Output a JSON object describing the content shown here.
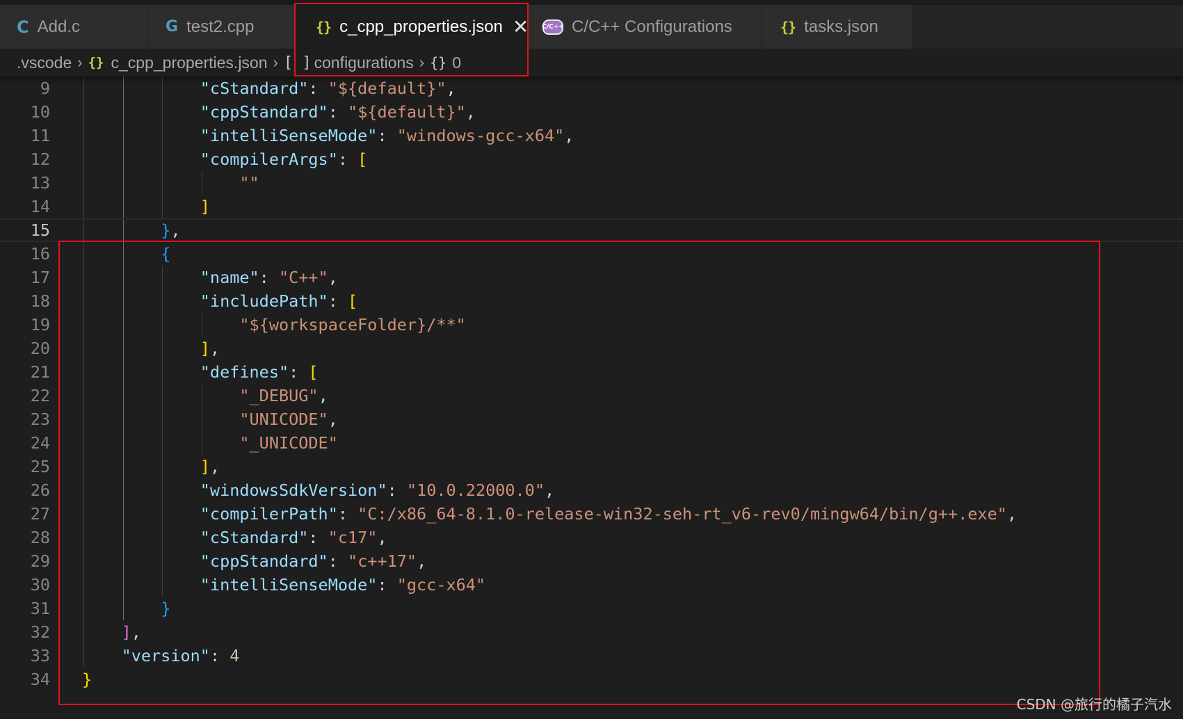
{
  "tabs": [
    {
      "label": "Add.c",
      "icon": "c-file-icon",
      "glyph": "C"
    },
    {
      "label": "test2.cpp",
      "icon": "cpp-file-icon",
      "glyph": "G"
    },
    {
      "label": "c_cpp_properties.json",
      "icon": "json-file-icon",
      "glyph": "{}",
      "active": true,
      "close": "✕"
    },
    {
      "label": "C/C++ Configurations",
      "icon": "cpp-configurations-icon",
      "glyph": "C/C++"
    },
    {
      "label": "tasks.json",
      "icon": "json-file-icon",
      "glyph": "{}"
    }
  ],
  "breadcrumb": {
    "folder": ".vscode",
    "file": "c_cpp_properties.json",
    "file_glyph": "{}",
    "array_glyph": "[ ]",
    "array": "configurations",
    "object_glyph": "{}",
    "object": "0",
    "separator": "›"
  },
  "editor": {
    "current_line": 15,
    "lines": [
      {
        "n": 9,
        "tokens": [
          [
            "p",
            "            "
          ],
          [
            "k",
            "\"cStandard\""
          ],
          [
            "p",
            ": "
          ],
          [
            "s",
            "\"${default}\""
          ],
          [
            "p",
            ","
          ]
        ]
      },
      {
        "n": 10,
        "tokens": [
          [
            "p",
            "            "
          ],
          [
            "k",
            "\"cppStandard\""
          ],
          [
            "p",
            ": "
          ],
          [
            "s",
            "\"${default}\""
          ],
          [
            "p",
            ","
          ]
        ]
      },
      {
        "n": 11,
        "tokens": [
          [
            "p",
            "            "
          ],
          [
            "k",
            "\"intelliSenseMode\""
          ],
          [
            "p",
            ": "
          ],
          [
            "s",
            "\"windows-gcc-x64\""
          ],
          [
            "p",
            ","
          ]
        ]
      },
      {
        "n": 12,
        "tokens": [
          [
            "p",
            "            "
          ],
          [
            "k",
            "\"compilerArgs\""
          ],
          [
            "p",
            ": "
          ],
          [
            "b1",
            "["
          ]
        ]
      },
      {
        "n": 13,
        "tokens": [
          [
            "p",
            "                "
          ],
          [
            "s",
            "\"\""
          ]
        ]
      },
      {
        "n": 14,
        "tokens": [
          [
            "p",
            "            "
          ],
          [
            "b1",
            "]"
          ]
        ]
      },
      {
        "n": 15,
        "tokens": [
          [
            "p",
            "        "
          ],
          [
            "b3",
            "}"
          ],
          [
            "p",
            ","
          ]
        ]
      },
      {
        "n": 16,
        "tokens": [
          [
            "p",
            "        "
          ],
          [
            "b3",
            "{"
          ]
        ]
      },
      {
        "n": 17,
        "tokens": [
          [
            "p",
            "            "
          ],
          [
            "k",
            "\"name\""
          ],
          [
            "p",
            ": "
          ],
          [
            "s",
            "\"C++\""
          ],
          [
            "p",
            ","
          ]
        ]
      },
      {
        "n": 18,
        "tokens": [
          [
            "p",
            "            "
          ],
          [
            "k",
            "\"includePath\""
          ],
          [
            "p",
            ": "
          ],
          [
            "b1",
            "["
          ]
        ]
      },
      {
        "n": 19,
        "tokens": [
          [
            "p",
            "                "
          ],
          [
            "s",
            "\"${workspaceFolder}/**\""
          ]
        ]
      },
      {
        "n": 20,
        "tokens": [
          [
            "p",
            "            "
          ],
          [
            "b1",
            "]"
          ],
          [
            "p",
            ","
          ]
        ]
      },
      {
        "n": 21,
        "tokens": [
          [
            "p",
            "            "
          ],
          [
            "k",
            "\"defines\""
          ],
          [
            "p",
            ": "
          ],
          [
            "b1",
            "["
          ]
        ]
      },
      {
        "n": 22,
        "tokens": [
          [
            "p",
            "                "
          ],
          [
            "s",
            "\"_DEBUG\""
          ],
          [
            "p",
            ","
          ]
        ]
      },
      {
        "n": 23,
        "tokens": [
          [
            "p",
            "                "
          ],
          [
            "s",
            "\"UNICODE\""
          ],
          [
            "p",
            ","
          ]
        ]
      },
      {
        "n": 24,
        "tokens": [
          [
            "p",
            "                "
          ],
          [
            "s",
            "\"_UNICODE\""
          ]
        ]
      },
      {
        "n": 25,
        "tokens": [
          [
            "p",
            "            "
          ],
          [
            "b1",
            "]"
          ],
          [
            "p",
            ","
          ]
        ]
      },
      {
        "n": 26,
        "tokens": [
          [
            "p",
            "            "
          ],
          [
            "k",
            "\"windowsSdkVersion\""
          ],
          [
            "p",
            ": "
          ],
          [
            "s",
            "\"10.0.22000.0\""
          ],
          [
            "p",
            ","
          ]
        ]
      },
      {
        "n": 27,
        "tokens": [
          [
            "p",
            "            "
          ],
          [
            "k",
            "\"compilerPath\""
          ],
          [
            "p",
            ": "
          ],
          [
            "s",
            "\"C:/x86_64-8.1.0-release-win32-seh-rt_v6-rev0/mingw64/bin/g++.exe\""
          ],
          [
            "p",
            ","
          ]
        ]
      },
      {
        "n": 28,
        "tokens": [
          [
            "p",
            "            "
          ],
          [
            "k",
            "\"cStandard\""
          ],
          [
            "p",
            ": "
          ],
          [
            "s",
            "\"c17\""
          ],
          [
            "p",
            ","
          ]
        ]
      },
      {
        "n": 29,
        "tokens": [
          [
            "p",
            "            "
          ],
          [
            "k",
            "\"cppStandard\""
          ],
          [
            "p",
            ": "
          ],
          [
            "s",
            "\"c++17\""
          ],
          [
            "p",
            ","
          ]
        ]
      },
      {
        "n": 30,
        "tokens": [
          [
            "p",
            "            "
          ],
          [
            "k",
            "\"intelliSenseMode\""
          ],
          [
            "p",
            ": "
          ],
          [
            "s",
            "\"gcc-x64\""
          ]
        ]
      },
      {
        "n": 31,
        "tokens": [
          [
            "p",
            "        "
          ],
          [
            "b3",
            "}"
          ]
        ]
      },
      {
        "n": 32,
        "tokens": [
          [
            "p",
            "    "
          ],
          [
            "b2",
            "]"
          ],
          [
            "p",
            ","
          ]
        ]
      },
      {
        "n": 33,
        "tokens": [
          [
            "p",
            "    "
          ],
          [
            "k",
            "\"version\""
          ],
          [
            "p",
            ": "
          ],
          [
            "n",
            "4"
          ]
        ]
      },
      {
        "n": 34,
        "tokens": [
          [
            "b1",
            "}"
          ]
        ]
      }
    ]
  },
  "watermark": "CSDN @旅行的橘子汽水",
  "colors": {
    "highlight_box": "#e0121b",
    "editor_bg": "#1e1e1e",
    "key": "#9cdcfe",
    "string": "#ce9178",
    "number": "#b5cea8"
  }
}
